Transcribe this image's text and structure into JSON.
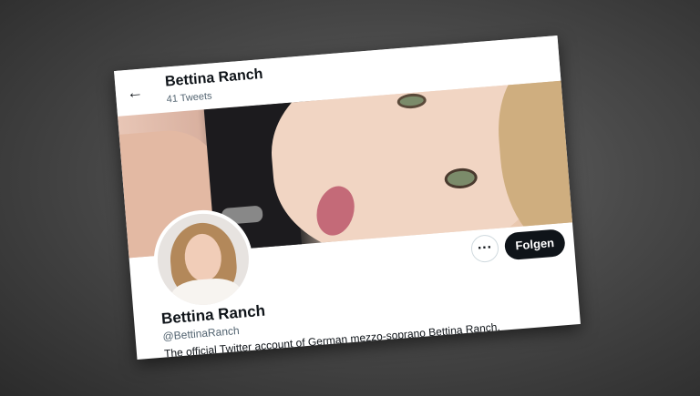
{
  "header": {
    "back_icon": "arrow-left-icon",
    "name": "Bettina Ranch",
    "tweet_count": "41 Tweets"
  },
  "actions": {
    "more_label": "···",
    "follow_label": "Folgen"
  },
  "profile": {
    "name": "Bettina Ranch",
    "handle": "@BettinaRanch",
    "bio": "The official Twitter account of German mezzo-soprano Bettina Ranch."
  },
  "colors": {
    "text_primary": "#0f1419",
    "text_secondary": "#536471",
    "follow_bg": "#0f1419"
  }
}
